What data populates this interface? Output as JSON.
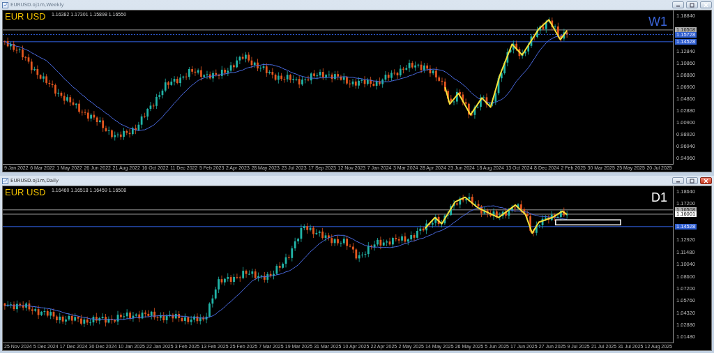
{
  "windows": [
    {
      "title": "EURUSD.oj1m,Weekly",
      "active": false,
      "symbol_label": "EUR USD",
      "ohlc": "1.16382 1.17301 1.15898 1.16550",
      "timeframe_label": "W1",
      "price_axis": [
        {
          "text": "1.18840",
          "kind": "tick"
        },
        {
          "text": "1.16508",
          "kind": "last"
        },
        {
          "text": "1.15728",
          "kind": "dotted"
        },
        {
          "text": "1.14528",
          "kind": "level"
        },
        {
          "text": "1.12840",
          "kind": "tick"
        },
        {
          "text": "1.10860",
          "kind": "tick"
        },
        {
          "text": "1.08880",
          "kind": "tick"
        },
        {
          "text": "1.06900",
          "kind": "tick"
        },
        {
          "text": "1.04860",
          "kind": "tick"
        },
        {
          "text": "1.02880",
          "kind": "tick"
        },
        {
          "text": "1.00900",
          "kind": "tick"
        },
        {
          "text": "0.98920",
          "kind": "tick"
        },
        {
          "text": "0.96940",
          "kind": "tick"
        },
        {
          "text": "0.94960",
          "kind": "tick"
        }
      ],
      "time_axis": [
        "9 Jan 2022",
        "6 Mar 2022",
        "1 May 2022",
        "26 Jun 2022",
        "21 Aug 2022",
        "16 Oct 2022",
        "11 Dec 2022",
        "5 Feb 2023",
        "2 Apr 2023",
        "28 May 2023",
        "23 Jul 2023",
        "17 Sep 2023",
        "12 Nov 2023",
        "7 Jan 2024",
        "3 Mar 2024",
        "28 Apr 2024",
        "23 Jun 2024",
        "18 Aug 2024",
        "13 Oct 2024",
        "8 Dec 2024",
        "2 Feb 2025",
        "30 Mar 2025",
        "25 May 2025",
        "20 Jul 2025"
      ]
    },
    {
      "title": "EURUSD.oj1m,Daily",
      "active": true,
      "symbol_label": "EUR USD",
      "ohlc": "1.16460 1.16518 1.16459 1.16508",
      "timeframe_label": "D1",
      "price_axis": [
        {
          "text": "1.18640",
          "kind": "tick"
        },
        {
          "text": "1.17200",
          "kind": "tick"
        },
        {
          "text": "1.16508",
          "kind": "last"
        },
        {
          "text": "1.16001",
          "kind": "cursor"
        },
        {
          "text": "1.14528",
          "kind": "level"
        },
        {
          "text": "1.12920",
          "kind": "tick"
        },
        {
          "text": "1.11480",
          "kind": "tick"
        },
        {
          "text": "1.10040",
          "kind": "tick"
        },
        {
          "text": "1.08600",
          "kind": "tick"
        },
        {
          "text": "1.07200",
          "kind": "tick"
        },
        {
          "text": "1.05760",
          "kind": "tick"
        },
        {
          "text": "1.04320",
          "kind": "tick"
        },
        {
          "text": "1.02880",
          "kind": "tick"
        },
        {
          "text": "1.01480",
          "kind": "tick"
        }
      ],
      "time_axis": [
        "25 Nov 2024",
        "5 Dec 2024",
        "17 Dec 2024",
        "30 Dec 2024",
        "10 Jan 2025",
        "22 Jan 2025",
        "3 Feb 2025",
        "13 Feb 2025",
        "25 Feb 2025",
        "7 Mar 2025",
        "19 Mar 2025",
        "31 Mar 2025",
        "10 Apr 2025",
        "22 Apr 2025",
        "2 May 2025",
        "14 May 2025",
        "26 May 2025",
        "5 Jun 2025",
        "17 Jun 2025",
        "27 Jun 2025",
        "9 Jul 2025",
        "21 Jul 2025",
        "31 Jul 2025",
        "12 Aug 2025"
      ]
    }
  ]
}
